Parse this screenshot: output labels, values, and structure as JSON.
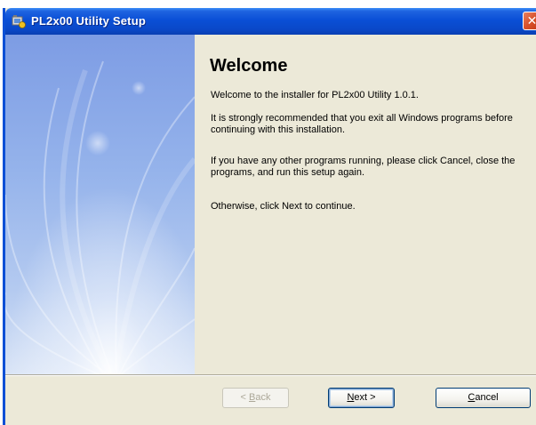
{
  "window": {
    "title": "PL2x00 Utility Setup",
    "close_glyph": "✕"
  },
  "icons": {
    "title_icon": "setup-icon",
    "close_icon": "close-icon"
  },
  "colors": {
    "titlebar": "#0a4fd6",
    "dialog_bg": "#ece9d8",
    "close_button": "#d8502a",
    "side_panel": "#95b3eb"
  },
  "content": {
    "heading": "Welcome",
    "paragraphs": [
      "Welcome to the installer for PL2x00 Utility 1.0.1.",
      "It is strongly recommended that you exit all Windows programs before continuing with this installation.",
      "If you have any other programs running, please click Cancel, close the programs, and run this setup again.",
      "Otherwise, click Next to continue."
    ]
  },
  "buttons": {
    "back": {
      "prefix": "< ",
      "mnemonic": "B",
      "rest": "ack",
      "enabled": false
    },
    "next": {
      "mnemonic": "N",
      "rest": "ext >",
      "enabled": true
    },
    "cancel": {
      "mnemonic": "C",
      "rest": "ancel",
      "enabled": true
    }
  }
}
